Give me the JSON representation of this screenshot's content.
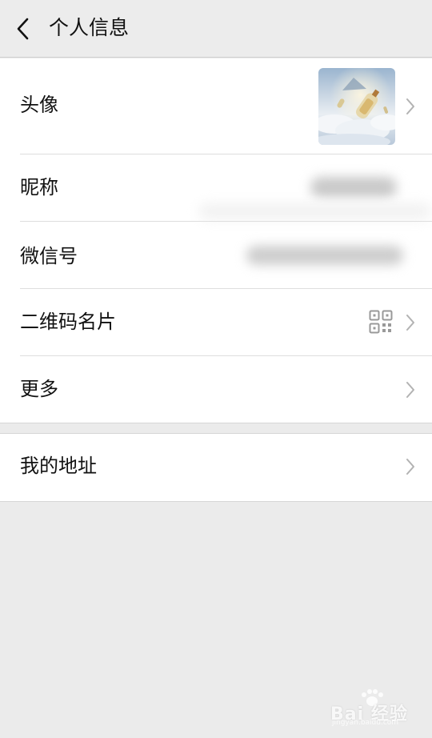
{
  "header": {
    "title": "个人信息",
    "back_icon": "chevron-left-icon"
  },
  "profile": {
    "avatar_label": "头像",
    "nickname_label": "昵称",
    "wechat_id_label": "微信号",
    "qr_card_label": "二维码名片",
    "more_label": "更多"
  },
  "address": {
    "label": "我的地址"
  },
  "watermark": {
    "text": "Bai 经验",
    "sub": "jingyan.baidu.com"
  },
  "colors": {
    "background": "#ebebeb",
    "card": "#ffffff",
    "text": "#111111",
    "chevron": "#b2b2b2"
  }
}
